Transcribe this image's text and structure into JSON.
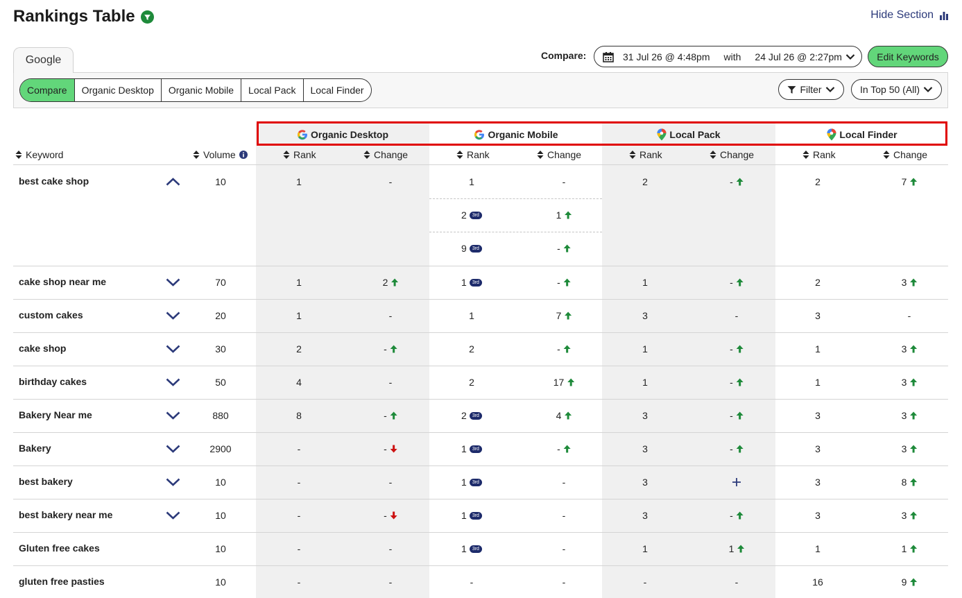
{
  "header": {
    "title": "Rankings Table",
    "hide_label": "Hide Section"
  },
  "engine_tab": "Google",
  "tabs": [
    "Compare",
    "Organic Desktop",
    "Organic Mobile",
    "Local Pack",
    "Local Finder"
  ],
  "active_tab": "Compare",
  "compare": {
    "label": "Compare:",
    "from": "31 Jul 26 @ 4:48pm",
    "with": "with",
    "to": "24 Jul 26 @ 2:27pm"
  },
  "edit_keywords": "Edit Keywords",
  "filter_label": "Filter",
  "top_label": "In Top 50 (All)",
  "groups": [
    "Organic Desktop",
    "Organic Mobile",
    "Local Pack",
    "Local Finder"
  ],
  "columns": {
    "keyword": "Keyword",
    "volume": "Volume",
    "rank": "Rank",
    "change": "Change"
  },
  "badge_text": "3rd",
  "rows": [
    {
      "keyword": "best cake shop",
      "volume": "10",
      "expanded": true,
      "od": [
        [
          "1",
          "-",
          ""
        ]
      ],
      "om": [
        [
          "1",
          "-",
          "",
          false
        ],
        [
          "2",
          "1",
          "up",
          true
        ],
        [
          "9",
          "-",
          "up",
          true
        ]
      ],
      "lp": [
        "2",
        "-",
        "up"
      ],
      "lf": [
        "2",
        "7",
        "up"
      ]
    },
    {
      "keyword": "cake shop near me",
      "volume": "70",
      "expanded": false,
      "od": [
        [
          "1",
          "2",
          "up"
        ]
      ],
      "om": [
        [
          "1",
          "-",
          "up",
          true
        ]
      ],
      "lp": [
        "1",
        "-",
        "up"
      ],
      "lf": [
        "2",
        "3",
        "up"
      ]
    },
    {
      "keyword": "custom cakes",
      "volume": "20",
      "expanded": false,
      "od": [
        [
          "1",
          "-",
          ""
        ]
      ],
      "om": [
        [
          "1",
          "7",
          "up",
          false
        ]
      ],
      "lp": [
        "3",
        "-",
        ""
      ],
      "lf": [
        "3",
        "-",
        ""
      ]
    },
    {
      "keyword": "cake shop",
      "volume": "30",
      "expanded": false,
      "od": [
        [
          "2",
          "-",
          "up"
        ]
      ],
      "om": [
        [
          "2",
          "-",
          "up",
          false
        ]
      ],
      "lp": [
        "1",
        "-",
        "up"
      ],
      "lf": [
        "1",
        "3",
        "up"
      ]
    },
    {
      "keyword": "birthday cakes",
      "volume": "50",
      "expanded": false,
      "od": [
        [
          "4",
          "-",
          ""
        ]
      ],
      "om": [
        [
          "2",
          "17",
          "up",
          false
        ]
      ],
      "lp": [
        "1",
        "-",
        "up"
      ],
      "lf": [
        "1",
        "3",
        "up"
      ]
    },
    {
      "keyword": "Bakery Near me",
      "volume": "880",
      "expanded": false,
      "od": [
        [
          "8",
          "-",
          "up"
        ]
      ],
      "om": [
        [
          "2",
          "4",
          "up",
          true
        ]
      ],
      "lp": [
        "3",
        "-",
        "up"
      ],
      "lf": [
        "3",
        "3",
        "up"
      ]
    },
    {
      "keyword": "Bakery",
      "volume": "2900",
      "expanded": false,
      "od": [
        [
          "-",
          "-",
          "down"
        ]
      ],
      "om": [
        [
          "1",
          "-",
          "up",
          true
        ]
      ],
      "lp": [
        "3",
        "-",
        "up"
      ],
      "lf": [
        "3",
        "3",
        "up"
      ]
    },
    {
      "keyword": "best bakery",
      "volume": "10",
      "expanded": false,
      "od": [
        [
          "-",
          "-",
          ""
        ]
      ],
      "om": [
        [
          "1",
          "-",
          "",
          true
        ]
      ],
      "lp": [
        "3",
        "",
        "new"
      ],
      "lf": [
        "3",
        "8",
        "up"
      ]
    },
    {
      "keyword": "best bakery near me",
      "volume": "10",
      "expanded": false,
      "od": [
        [
          "-",
          "-",
          "down"
        ]
      ],
      "om": [
        [
          "1",
          "-",
          "",
          true
        ]
      ],
      "lp": [
        "3",
        "-",
        "up"
      ],
      "lf": [
        "3",
        "3",
        "up"
      ]
    },
    {
      "keyword": "Gluten free cakes",
      "volume": "10",
      "expanded": null,
      "od": [
        [
          "-",
          "-",
          ""
        ]
      ],
      "om": [
        [
          "1",
          "-",
          "",
          true
        ]
      ],
      "lp": [
        "1",
        "1",
        "up"
      ],
      "lf": [
        "1",
        "1",
        "up"
      ]
    },
    {
      "keyword": "gluten free pasties",
      "volume": "10",
      "expanded": null,
      "od": [
        [
          "-",
          "-",
          ""
        ]
      ],
      "om": [
        [
          "-",
          "-",
          "",
          false
        ]
      ],
      "lp": [
        "-",
        "-",
        ""
      ],
      "lf": [
        "16",
        "9",
        "up"
      ]
    }
  ],
  "colors": {
    "accent_green": "#62d67a",
    "up_arrow": "#1e8a3a",
    "down_arrow": "#cc1111",
    "nav_blue": "#2c3a7a",
    "highlight_red": "#e00000"
  }
}
